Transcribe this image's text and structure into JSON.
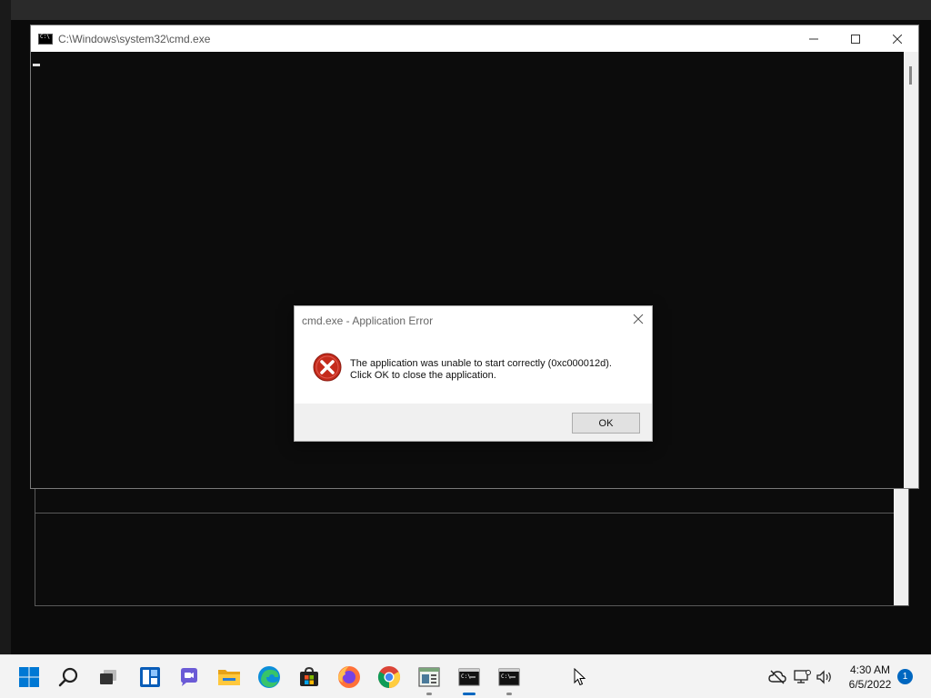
{
  "cmd_window": {
    "title": "C:\\Windows\\system32\\cmd.exe"
  },
  "error_dialog": {
    "title": "cmd.exe - Application Error",
    "message_line1": "The application was unable to start correctly (0xc000012d).",
    "message_line2": "Click OK to close the application.",
    "ok_label": "OK"
  },
  "taskbar": {
    "apps": [
      {
        "name": "start",
        "icon": "windows-logo-icon"
      },
      {
        "name": "search",
        "icon": "search-icon"
      },
      {
        "name": "task-view",
        "icon": "task-view-icon"
      },
      {
        "name": "widgets",
        "icon": "widgets-icon"
      },
      {
        "name": "chat",
        "icon": "chat-icon"
      },
      {
        "name": "file-explorer",
        "icon": "folder-icon"
      },
      {
        "name": "edge",
        "icon": "edge-icon"
      },
      {
        "name": "store",
        "icon": "store-icon"
      },
      {
        "name": "firefox",
        "icon": "firefox-icon"
      },
      {
        "name": "chrome",
        "icon": "chrome-icon"
      },
      {
        "name": "app",
        "icon": "app-window-icon"
      },
      {
        "name": "cmd-active",
        "icon": "cmd-icon"
      },
      {
        "name": "cmd",
        "icon": "cmd-icon"
      }
    ],
    "clock_time": "4:30 AM",
    "clock_date": "6/5/2022",
    "notification_count": "1"
  },
  "colors": {
    "console_bg": "#0c0c0c",
    "error_red": "#c42b1c",
    "accent": "#0067c0"
  }
}
